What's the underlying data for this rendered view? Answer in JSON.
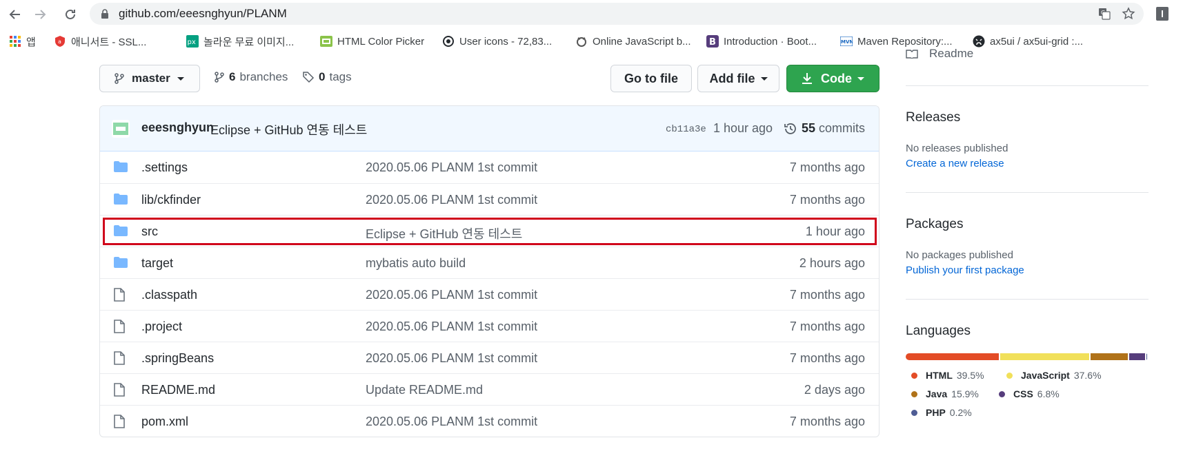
{
  "browser": {
    "url": "github.com/eeesnghyun/PLANM",
    "bookmarks": [
      {
        "label": "앱",
        "icon": "apps-grid-icon"
      },
      {
        "label": "애니서트 - SSL...",
        "icon": "shield-badge-icon"
      },
      {
        "label": "놀라운 무료 이미지...",
        "icon": "px-logo-icon"
      },
      {
        "label": "HTML Color Picker",
        "icon": "color-picker-icon"
      },
      {
        "label": "User icons - 72,83...",
        "icon": "user-icons-logo-icon"
      },
      {
        "label": "Online JavaScript b...",
        "icon": "js-beautifier-icon"
      },
      {
        "label": "Introduction · Boot...",
        "icon": "bootstrap-icon"
      },
      {
        "label": "Maven Repository:...",
        "icon": "maven-icon"
      },
      {
        "label": "ax5ui / ax5ui-grid :...",
        "icon": "github-logo-icon"
      }
    ]
  },
  "repo_bar": {
    "branch": "master",
    "branches_count": "6",
    "branches_label": "branches",
    "tags_count": "0",
    "tags_label": "tags",
    "go_to_file": "Go to file",
    "add_file": "Add file",
    "code": "Code"
  },
  "latest_commit": {
    "author": "eeesnghyun",
    "message": "Eclipse + GitHub 연동 테스트",
    "sha": "cb11a3e",
    "when": "1 hour ago",
    "commits_count": "55",
    "commits_label": "commits"
  },
  "files": [
    {
      "type": "folder",
      "name": ".settings",
      "message": "2020.05.06 PLANM 1st commit",
      "age": "7 months ago"
    },
    {
      "type": "folder",
      "name": "lib/ckfinder",
      "message": "2020.05.06 PLANM 1st commit",
      "age": "7 months ago"
    },
    {
      "type": "folder",
      "name": "src",
      "message": "Eclipse + GitHub 연동 테스트",
      "age": "1 hour ago"
    },
    {
      "type": "folder",
      "name": "target",
      "message": "mybatis auto build",
      "age": "2 hours ago"
    },
    {
      "type": "file",
      "name": ".classpath",
      "message": "2020.05.06 PLANM 1st commit",
      "age": "7 months ago"
    },
    {
      "type": "file",
      "name": ".project",
      "message": "2020.05.06 PLANM 1st commit",
      "age": "7 months ago"
    },
    {
      "type": "file",
      "name": ".springBeans",
      "message": "2020.05.06 PLANM 1st commit",
      "age": "7 months ago"
    },
    {
      "type": "file",
      "name": "README.md",
      "message": "Update README.md",
      "age": "2 days ago"
    },
    {
      "type": "file",
      "name": "pom.xml",
      "message": "2020.05.06 PLANM 1st commit",
      "age": "7 months ago"
    }
  ],
  "sidebar": {
    "readme_fragment": "Readme",
    "releases_title": "Releases",
    "releases_empty": "No releases published",
    "releases_link": "Create a new release",
    "packages_title": "Packages",
    "packages_empty": "No packages published",
    "packages_link": "Publish your first package",
    "languages_title": "Languages",
    "languages": [
      {
        "name": "HTML",
        "percent": "39.5%",
        "value": 39.5,
        "color": "#e34c26"
      },
      {
        "name": "JavaScript",
        "percent": "37.6%",
        "value": 37.6,
        "color": "#f1e05a"
      },
      {
        "name": "Java",
        "percent": "15.9%",
        "value": 15.9,
        "color": "#b07219"
      },
      {
        "name": "CSS",
        "percent": "6.8%",
        "value": 6.8,
        "color": "#563d7c"
      },
      {
        "name": "PHP",
        "percent": "0.2%",
        "value": 0.2,
        "color": "#4f5d95"
      }
    ]
  },
  "colors": {
    "link": "#0366d6",
    "code_button": "#2ea44f",
    "highlight_box": "#d0021b",
    "folder_icon": "#79b8ff"
  }
}
